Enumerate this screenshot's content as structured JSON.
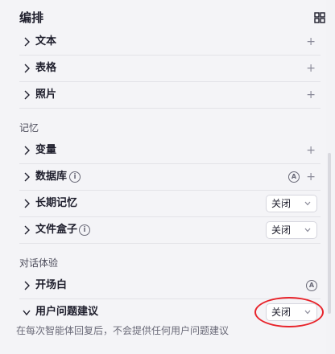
{
  "header": {
    "title": "编排",
    "icon": "grid-layout-icon"
  },
  "sections": {
    "arrange": {
      "items": [
        {
          "label": "文本",
          "action": "+"
        },
        {
          "label": "表格",
          "action": "+"
        },
        {
          "label": "照片",
          "action": "+"
        }
      ]
    },
    "memory": {
      "title": "记忆",
      "items": [
        {
          "label": "变量",
          "action": "+"
        },
        {
          "label": "数据库",
          "info": "i",
          "auto_badge": "A",
          "action": "+"
        },
        {
          "label": "长期记忆",
          "select_value": "关闭"
        },
        {
          "label": "文件盒子",
          "info": "i",
          "select_value": "关闭"
        }
      ]
    },
    "dialog": {
      "title": "对话体验",
      "items": [
        {
          "label": "开场白",
          "auto_badge": "A"
        },
        {
          "label": "用户问题建议",
          "select_value": "关闭"
        }
      ],
      "hint": "在每次智能体回复后，不会提供任何用户问题建议"
    }
  },
  "colors": {
    "annotation_circle": "#e8242b",
    "background": "#f4f4f7"
  }
}
